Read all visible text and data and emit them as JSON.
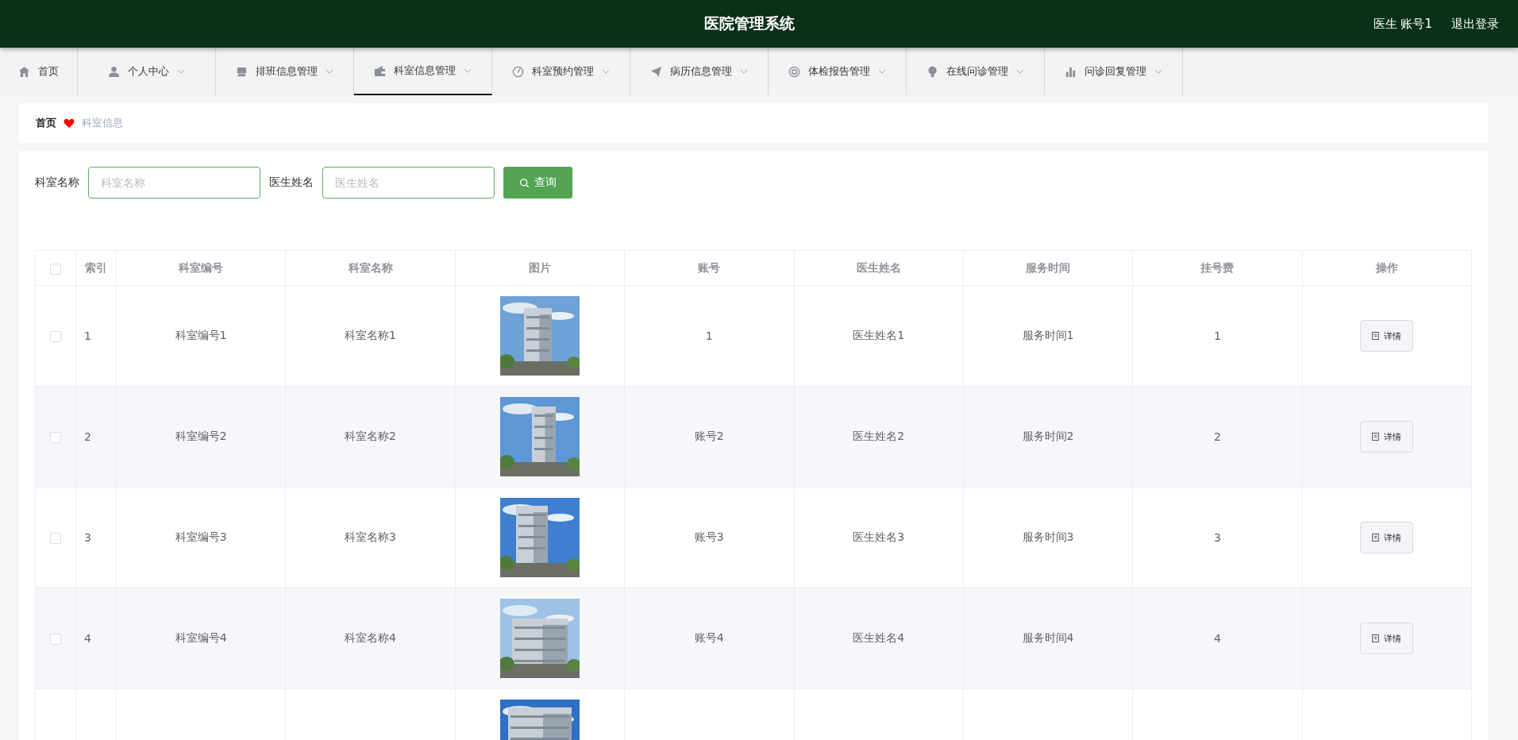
{
  "header": {
    "title": "医院管理系统",
    "user": "医生 账号1",
    "logout": "退出登录"
  },
  "nav": [
    {
      "label": "首页",
      "dropdown": false,
      "selected": false
    },
    {
      "label": "个人中心",
      "dropdown": true,
      "selected": false
    },
    {
      "label": "排班信息管理",
      "dropdown": true,
      "selected": false
    },
    {
      "label": "科室信息管理",
      "dropdown": true,
      "selected": true
    },
    {
      "label": "科室预约管理",
      "dropdown": true,
      "selected": false
    },
    {
      "label": "病历信息管理",
      "dropdown": true,
      "selected": false
    },
    {
      "label": "体检报告管理",
      "dropdown": true,
      "selected": false
    },
    {
      "label": "在线问诊管理",
      "dropdown": true,
      "selected": false
    },
    {
      "label": "问诊回复管理",
      "dropdown": true,
      "selected": false
    }
  ],
  "breadcrumb": {
    "home": "首页",
    "current": "科室信息"
  },
  "search": {
    "fields": [
      {
        "label": "科室名称",
        "placeholder": "科室名称"
      },
      {
        "label": "医生姓名",
        "placeholder": "医生姓名"
      }
    ],
    "button": "查询"
  },
  "table": {
    "all_checked": false,
    "columns": [
      "索引",
      "科室编号",
      "科室名称",
      "图片",
      "账号",
      "医生姓名",
      "服务时间",
      "挂号费",
      "操作"
    ],
    "rows": [
      {
        "checked": false,
        "cells": [
          "1",
          "科室编号1",
          "科室名称1",
          {
            "kind": "picture"
          },
          "1",
          "医生姓名1",
          "服务时间1",
          "1"
        ],
        "action": "详情"
      },
      {
        "checked": false,
        "cells": [
          "2",
          "科室编号2",
          "科室名称2",
          {
            "kind": "picture"
          },
          "账号2",
          "医生姓名2",
          "服务时间2",
          "2"
        ],
        "action": "详情"
      },
      {
        "checked": false,
        "cells": [
          "3",
          "科室编号3",
          "科室名称3",
          {
            "kind": "picture"
          },
          "账号3",
          "医生姓名3",
          "服务时间3",
          "3"
        ],
        "action": "详情"
      },
      {
        "checked": false,
        "cells": [
          "4",
          "科室编号4",
          "科室名称4",
          {
            "kind": "picture"
          },
          "账号4",
          "医生姓名4",
          "服务时间4",
          "4"
        ],
        "action": "详情"
      },
      {
        "cells": [
          null,
          null,
          null,
          {
            "kind": "picture"
          },
          null,
          null,
          null,
          null
        ]
      }
    ]
  }
}
